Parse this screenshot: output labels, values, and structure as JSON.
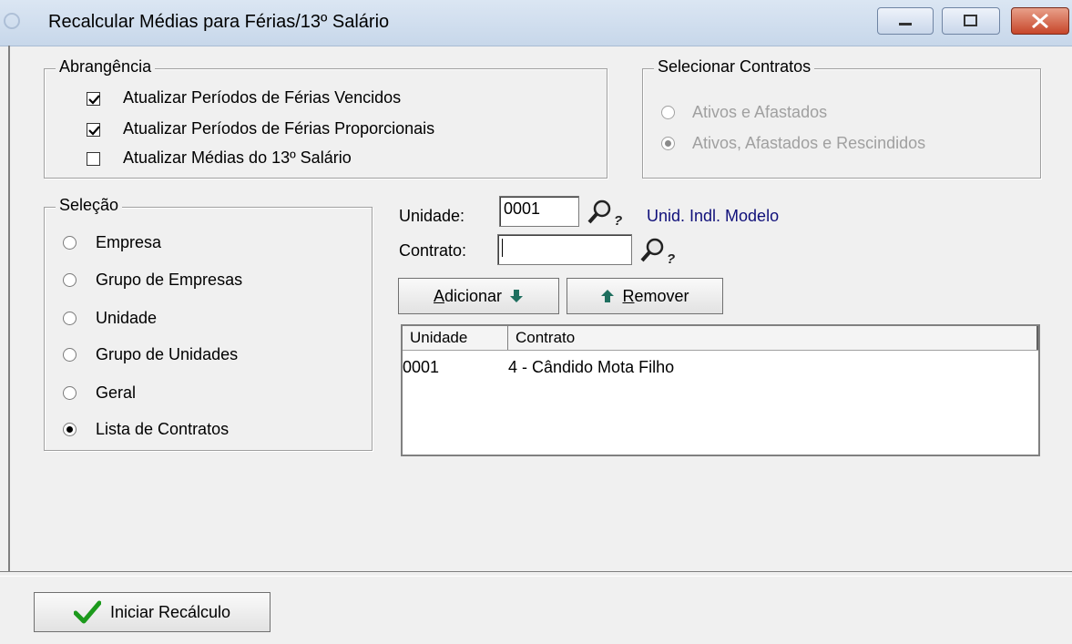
{
  "window": {
    "title": "Recalcular Médias para Férias/13º Salário"
  },
  "abrangencia": {
    "legend": "Abrangência",
    "items": [
      {
        "label": "Atualizar Períodos de Férias Vencidos",
        "checked": true
      },
      {
        "label": "Atualizar Períodos de Férias Proporcionais",
        "checked": true
      },
      {
        "label": "Atualizar Médias do 13º Salário",
        "checked": false
      }
    ]
  },
  "contratos": {
    "legend": "Selecionar Contratos",
    "options": [
      {
        "label": "Ativos e Afastados",
        "selected": false,
        "disabled": true
      },
      {
        "label": "Ativos, Afastados e Rescindidos",
        "selected": true,
        "disabled": true
      }
    ]
  },
  "selecao": {
    "legend": "Seleção",
    "options": [
      {
        "label": "Empresa",
        "selected": false
      },
      {
        "label": "Grupo de Empresas",
        "selected": false
      },
      {
        "label": "Unidade",
        "selected": false
      },
      {
        "label": "Grupo de Unidades",
        "selected": false
      },
      {
        "label": "Geral",
        "selected": false
      },
      {
        "label": "Lista de Contratos",
        "selected": true
      }
    ]
  },
  "form": {
    "unidade_label": "Unidade:",
    "unidade_value": "0001",
    "unidade_desc": "Unid. Indl. Modelo",
    "contrato_label": "Contrato:",
    "contrato_value": ""
  },
  "buttons": {
    "adicionar_rest": "dicionar",
    "adicionar_key": "A",
    "remover_key": "R",
    "remover_rest": "emover",
    "iniciar": "Iniciar Recálculo"
  },
  "table": {
    "columns": [
      "Unidade",
      "Contrato"
    ],
    "rows": [
      {
        "unidade": "0001",
        "contrato": "4 - Cândido Mota Filho"
      }
    ]
  },
  "colors": {
    "unit_desc": "#10107a",
    "check_green": "#1c9a1c",
    "arrow_teal": "#1f6f5f"
  }
}
